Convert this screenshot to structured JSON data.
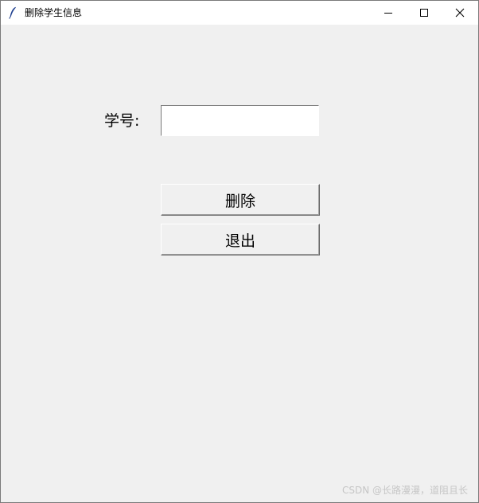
{
  "window": {
    "title": "删除学生信息"
  },
  "form": {
    "student_id_label": "学号:",
    "student_id_value": ""
  },
  "buttons": {
    "delete_label": "删除",
    "exit_label": "退出"
  },
  "watermark": {
    "text": "CSDN @长路漫漫，道阻且长"
  },
  "icons": {
    "app": "feather-icon",
    "minimize": "minimize-icon",
    "maximize": "maximize-icon",
    "close": "close-icon"
  },
  "colors": {
    "window_bg": "#f0f0f0",
    "titlebar_bg": "#ffffff",
    "entry_bg": "#ffffff",
    "watermark": "#c6c6c6"
  }
}
